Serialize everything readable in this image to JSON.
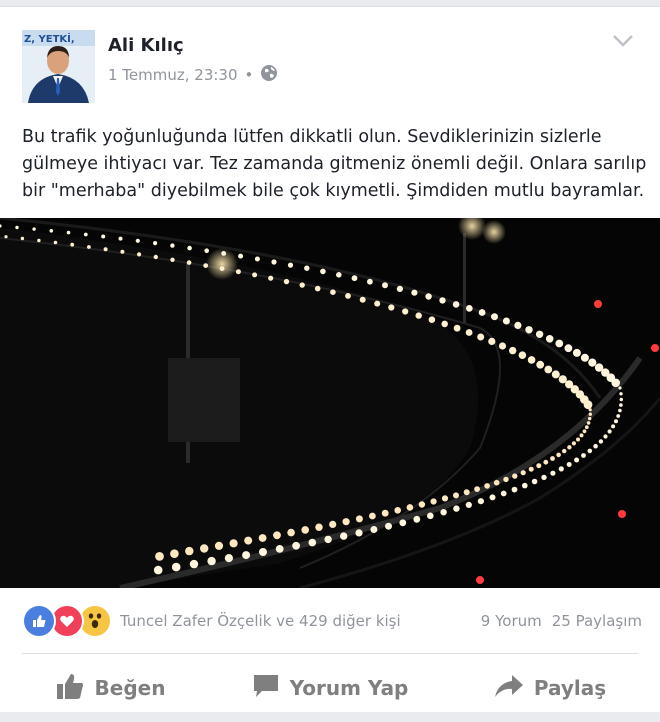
{
  "post": {
    "author": "Ali Kılıç",
    "timestamp": "1 Temmuz, 23:30",
    "separator": "•",
    "avatar_banner_text": "Z, YETKİ,",
    "text_lines": [
      "Bu trafik yoğunluğunda lütfen dikkatli olun. Sevdiklerinizin sizlerle",
      "gülmeye ihtiyacı var. Tez zamanda gitmeniz önemli değil. Onlara sarılıp",
      "bir \"merhaba\" diyebilmek bile çok kıymetli. Şimdiden mutlu bayramlar."
    ]
  },
  "reactions": {
    "names": "Tuncel Zafer Özçelik ve 429 diğer kişi",
    "comments": "9 Yorum",
    "shares": "25 Paylaşım",
    "icons": [
      "like-icon",
      "love-icon",
      "wow-icon"
    ]
  },
  "actions": {
    "like": "Beğen",
    "comment": "Yorum Yap",
    "share": "Paylaş"
  },
  "colors": {
    "like": "#4a7fe0",
    "love": "#f0405a",
    "wow": "#f7c544",
    "text": "#1d2129",
    "muted": "#90949c"
  }
}
